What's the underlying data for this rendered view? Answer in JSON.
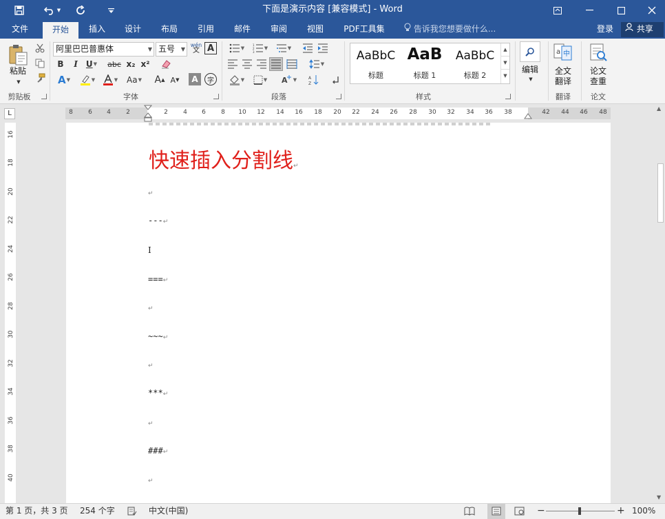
{
  "window": {
    "title": "下面是演示内容 [兼容模式] - Word",
    "controls": {
      "ribbon_display": "ribbon-display-icon",
      "minimize": "minimize-icon",
      "maximize": "maximize-icon",
      "close": "close-icon"
    }
  },
  "quick_access": {
    "save": "save-icon",
    "undo": "undo-icon",
    "redo": "redo-icon",
    "customize": "customize-icon"
  },
  "tabs": [
    {
      "label": "文件"
    },
    {
      "label": "开始",
      "active": true
    },
    {
      "label": "插入"
    },
    {
      "label": "设计"
    },
    {
      "label": "布局"
    },
    {
      "label": "引用"
    },
    {
      "label": "邮件"
    },
    {
      "label": "审阅"
    },
    {
      "label": "视图"
    },
    {
      "label": "PDF工具集"
    }
  ],
  "tell_me": "告诉我您想要做什么...",
  "account": {
    "login": "登录",
    "share": "共享"
  },
  "ribbon": {
    "clipboard": {
      "label": "剪贴板",
      "paste": "粘贴"
    },
    "font": {
      "label": "字体",
      "font_name": "阿里巴巴普惠体",
      "font_size": "五号",
      "bold": "B",
      "italic": "I",
      "underline": "U",
      "strike": "abc",
      "subscript": "x₂",
      "superscript": "x²",
      "case": "Aa",
      "grow": "A",
      "shrink": "A",
      "phonetic": "wén",
      "char_border": "A",
      "char_shading": "A",
      "enclose": "字",
      "font_color": "#e0201b",
      "highlight_color": "#ffee00"
    },
    "paragraph": {
      "label": "段落"
    },
    "styles": {
      "label": "样式",
      "items": [
        {
          "sample": "AaBbC",
          "name": "标题"
        },
        {
          "sample": "AaB",
          "name": "标题 1"
        },
        {
          "sample": "AaBbC",
          "name": "标题 2"
        }
      ]
    },
    "edit": {
      "label": "编辑"
    },
    "translate": {
      "label": "翻译",
      "full_translate": "全文\n翻译"
    },
    "thesis": {
      "label": "论文",
      "check": "论文\n查重"
    }
  },
  "ruler": {
    "ticks": [
      "8",
      "6",
      "4",
      "2",
      "2",
      "4",
      "6",
      "8",
      "10",
      "12",
      "14",
      "16",
      "18",
      "20",
      "22",
      "24",
      "26",
      "28",
      "30",
      "32",
      "34",
      "36",
      "38",
      "42",
      "44",
      "46",
      "48"
    ],
    "corner": "L"
  },
  "vruler": {
    "ticks": [
      "16",
      "18",
      "20",
      "22",
      "24",
      "26",
      "28",
      "30",
      "32",
      "34",
      "36",
      "38",
      "40"
    ]
  },
  "document": {
    "heading": "快速插入分割线",
    "paragraphs": [
      "",
      "---",
      "",
      "===",
      "",
      "~~~",
      "",
      "***",
      "",
      "###",
      ""
    ],
    "para_mark": "↵"
  },
  "status": {
    "page": "第 1 页，共 3 页",
    "words": "254 个字",
    "language": "中文(中国)",
    "zoom": "100%",
    "zoom_minus": "−",
    "zoom_plus": "+"
  }
}
